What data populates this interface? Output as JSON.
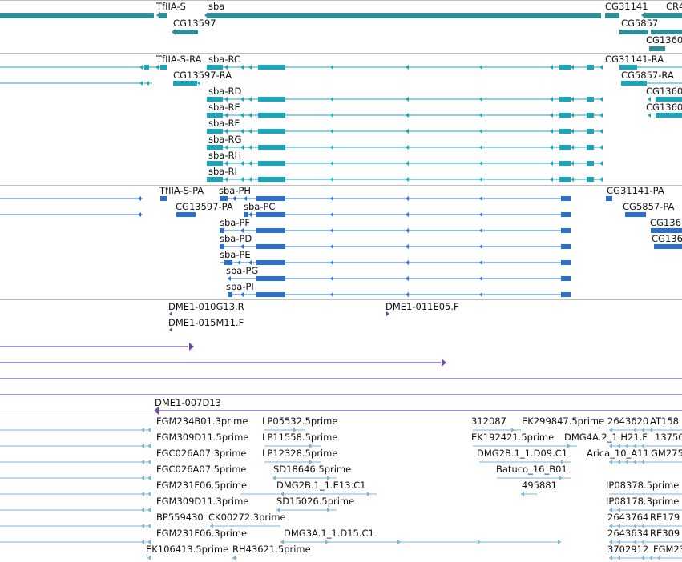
{
  "colors": {
    "gene": "#2f8f99",
    "transcript": "#17a7bd",
    "protein": "#2b6fd3",
    "clone": "#6e49a8",
    "est": "#7ab5de",
    "divider": "#c0c0c0"
  },
  "tracks": {
    "genes": [
      "TfIIA-S",
      "sba",
      "CG13597",
      "CG31141",
      "CG5857",
      "CR4",
      "CG1360"
    ],
    "transcripts": [
      "TfIIA-S-RA",
      "sba-RC",
      "CG31141-RA",
      "CG13597-RA",
      "CG5857-RA",
      "sba-RD",
      "CG1360",
      "sba-RE",
      "CG1360",
      "sba-RF",
      "sba-RG",
      "sba-RH",
      "sba-RI"
    ],
    "proteins": [
      "TfIIA-S-PA",
      "sba-PH",
      "CG31141-PA",
      "CG13597-PA",
      "sba-PC",
      "CG5857-PA",
      "sba-PF",
      "CG136",
      "sba-PD",
      "CG136",
      "sba-PE",
      "sba-PG",
      "sba-PI"
    ],
    "clones": [
      "DME1-010G13.R",
      "DME1-011E05.F",
      "DME1-015M11.F",
      "DME1-007D13"
    ],
    "ests": [
      "FGM234B01.3prime",
      "LP05532.5prime",
      "312087",
      "EK299847.5prime",
      "2643620",
      "AT158",
      "FGM309D11.5prime",
      "LP11558.5prime",
      "EK192421.5prime",
      "DMG4A.2_1.H21.F",
      "13750",
      "FGC026A07.3prime",
      "LP12328.5prime",
      "DMG2B.1_1.D09.C1",
      "Arica_10_A11",
      "GM275",
      "FGC026A07.5prime",
      "SD18646.5prime",
      "Batuco_16_B01",
      "FGM231F06.5prime",
      "DMG2B.1_1.E13.C1",
      "495881",
      "IP08378.5prime",
      "FGM309D11.3prime",
      "SD15026.5prime",
      "IP08178.3prime",
      "BP559430",
      "CK00272.3prime",
      "2643764",
      "RE179",
      "FGM231F06.3prime",
      "DMG3A.1_1.D15.C1",
      "2643634",
      "RE309",
      "EK106413.5prime",
      "RH43621.5prime",
      "3702912",
      "FGM23"
    ]
  }
}
